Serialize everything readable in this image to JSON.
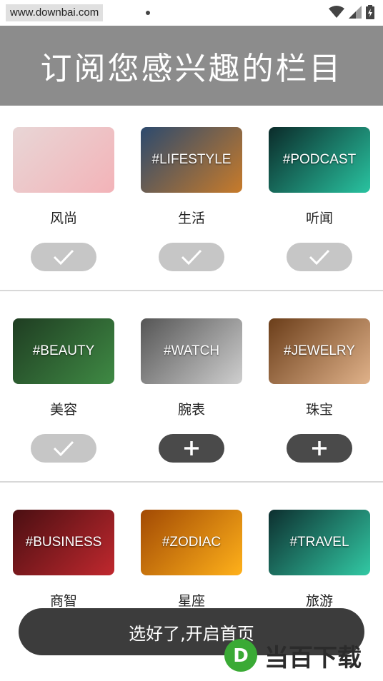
{
  "status_bar": {
    "url_watermark": "www.downbai.com"
  },
  "header": {
    "title": "订阅您感兴趣的栏目"
  },
  "categories": [
    {
      "label": "风尚",
      "tag": "",
      "subscribed": true,
      "thumb_colors": [
        "#e8d6d6",
        "#f3b3b8"
      ]
    },
    {
      "label": "生活",
      "tag": "#LIFESTYLE",
      "subscribed": true,
      "thumb_colors": [
        "#2c4a6e",
        "#c87b2a"
      ]
    },
    {
      "label": "听闻",
      "tag": "#PODCAST",
      "subscribed": true,
      "thumb_colors": [
        "#0b2b2a",
        "#29c3a0"
      ]
    },
    {
      "label": "美容",
      "tag": "#BEAUTY",
      "subscribed": true,
      "thumb_colors": [
        "#1f3d22",
        "#3f8a44"
      ]
    },
    {
      "label": "腕表",
      "tag": "#WATCH",
      "subscribed": false,
      "thumb_colors": [
        "#555555",
        "#cfcfcf"
      ]
    },
    {
      "label": "珠宝",
      "tag": "#JEWELRY",
      "subscribed": false,
      "thumb_colors": [
        "#6b3e1a",
        "#e0b28a"
      ]
    },
    {
      "label": "商智",
      "tag": "#BUSINESS",
      "subscribed": false,
      "thumb_colors": [
        "#4a0f12",
        "#c0282e"
      ]
    },
    {
      "label": "星座",
      "tag": "#ZODIAC",
      "subscribed": false,
      "thumb_colors": [
        "#a24a04",
        "#ffb11a"
      ]
    },
    {
      "label": "旅游",
      "tag": "#TRAVEL",
      "subscribed": false,
      "thumb_colors": [
        "#0d2f2f",
        "#32c9a4"
      ]
    }
  ],
  "cta": {
    "label": "选好了,开启首页"
  },
  "brand_watermark": {
    "text": "当百下载",
    "logo_letter": "D",
    "color": "#3aaa35"
  },
  "icons": {
    "subscribed": "check-icon",
    "unsubscribed": "plus-icon"
  }
}
